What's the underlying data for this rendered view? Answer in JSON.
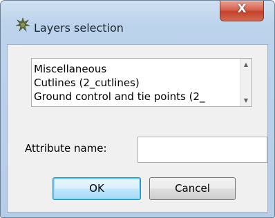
{
  "window": {
    "title": "Layers selection",
    "close_glyph": "X",
    "icon": "layers-app-icon"
  },
  "layers_list": {
    "items": [
      "Miscellaneous",
      "Cutlines (2_cutlines)",
      "Ground control and tie points (2_"
    ],
    "scroll_up_glyph": "▲",
    "scroll_down_glyph": "▼"
  },
  "attribute": {
    "label": "Attribute name:",
    "value": "",
    "placeholder": ""
  },
  "buttons": {
    "ok": "OK",
    "cancel": "Cancel"
  },
  "colors": {
    "close_button": "#c9462f",
    "default_button_border": "#3c7fb1"
  }
}
